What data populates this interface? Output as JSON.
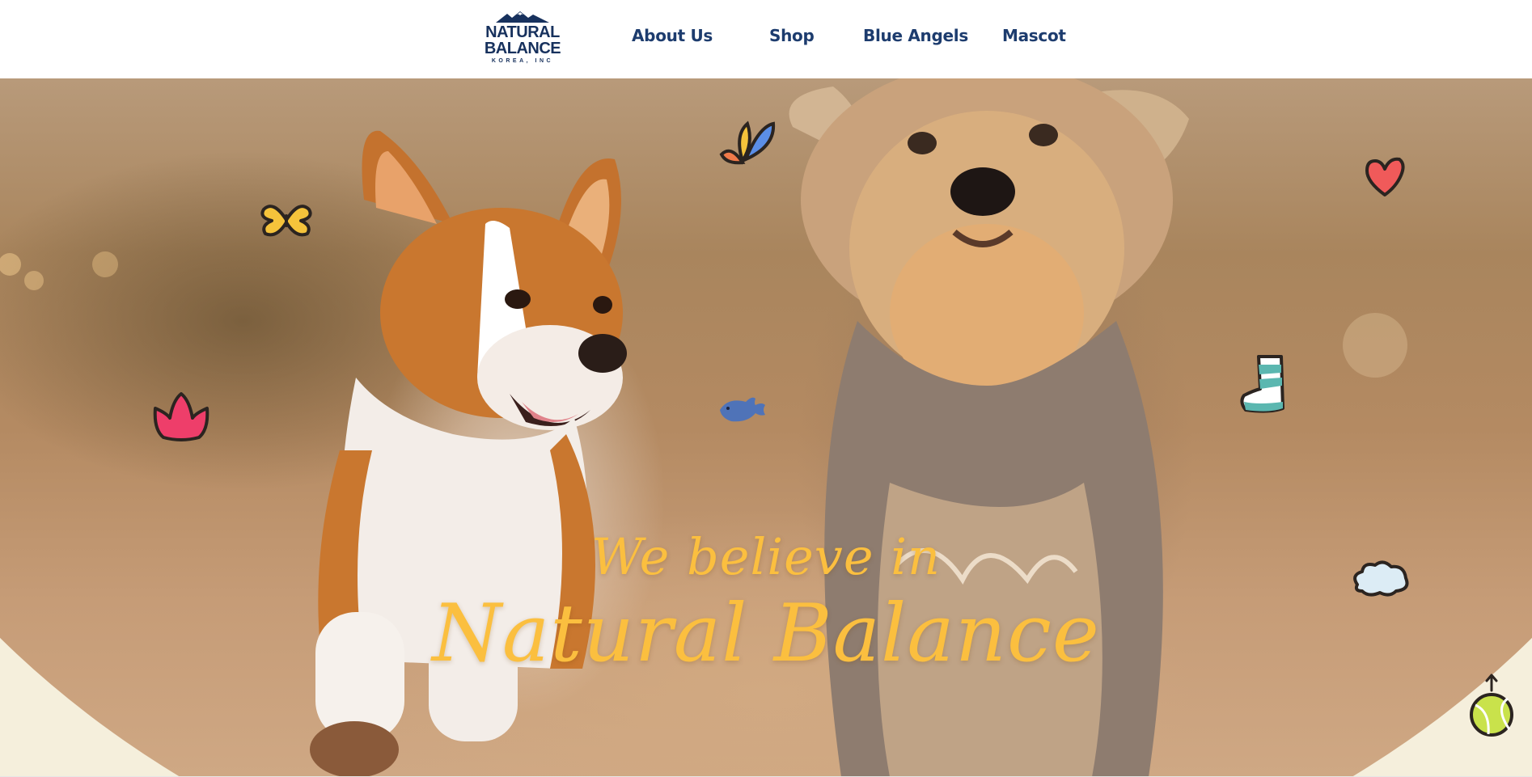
{
  "logo": {
    "line1": "NATURAL",
    "line2": "BALANCE",
    "line3": "KOREA, INC",
    "color": "#17315d"
  },
  "nav": {
    "items": [
      {
        "label": "About Us"
      },
      {
        "label": "Shop"
      },
      {
        "label": "Blue Angels"
      },
      {
        "label": "Mascot"
      }
    ],
    "color": "#1d3c6e"
  },
  "hero": {
    "tagline_line1": "We believe in",
    "tagline_line2": "Natural Balance",
    "tagline_color": "#fbbf3f",
    "background_bottom_color": "#f5efdc"
  },
  "doodles": [
    {
      "icon": "butterfly-icon",
      "color": "#f5c33b"
    },
    {
      "icon": "flower-petals-icon",
      "color": "#5b8ee6"
    },
    {
      "icon": "heart-icon",
      "color": "#f05a5a"
    },
    {
      "icon": "crown-icon",
      "color": "#ee3e6a"
    },
    {
      "icon": "fish-icon",
      "color": "#4f73b8"
    },
    {
      "icon": "sock-icon",
      "color": "#5bb7b0"
    },
    {
      "icon": "cloud-icon",
      "color": "#dcecf5"
    },
    {
      "icon": "tennis-ball-icon",
      "color": "#c9e24b"
    }
  ]
}
